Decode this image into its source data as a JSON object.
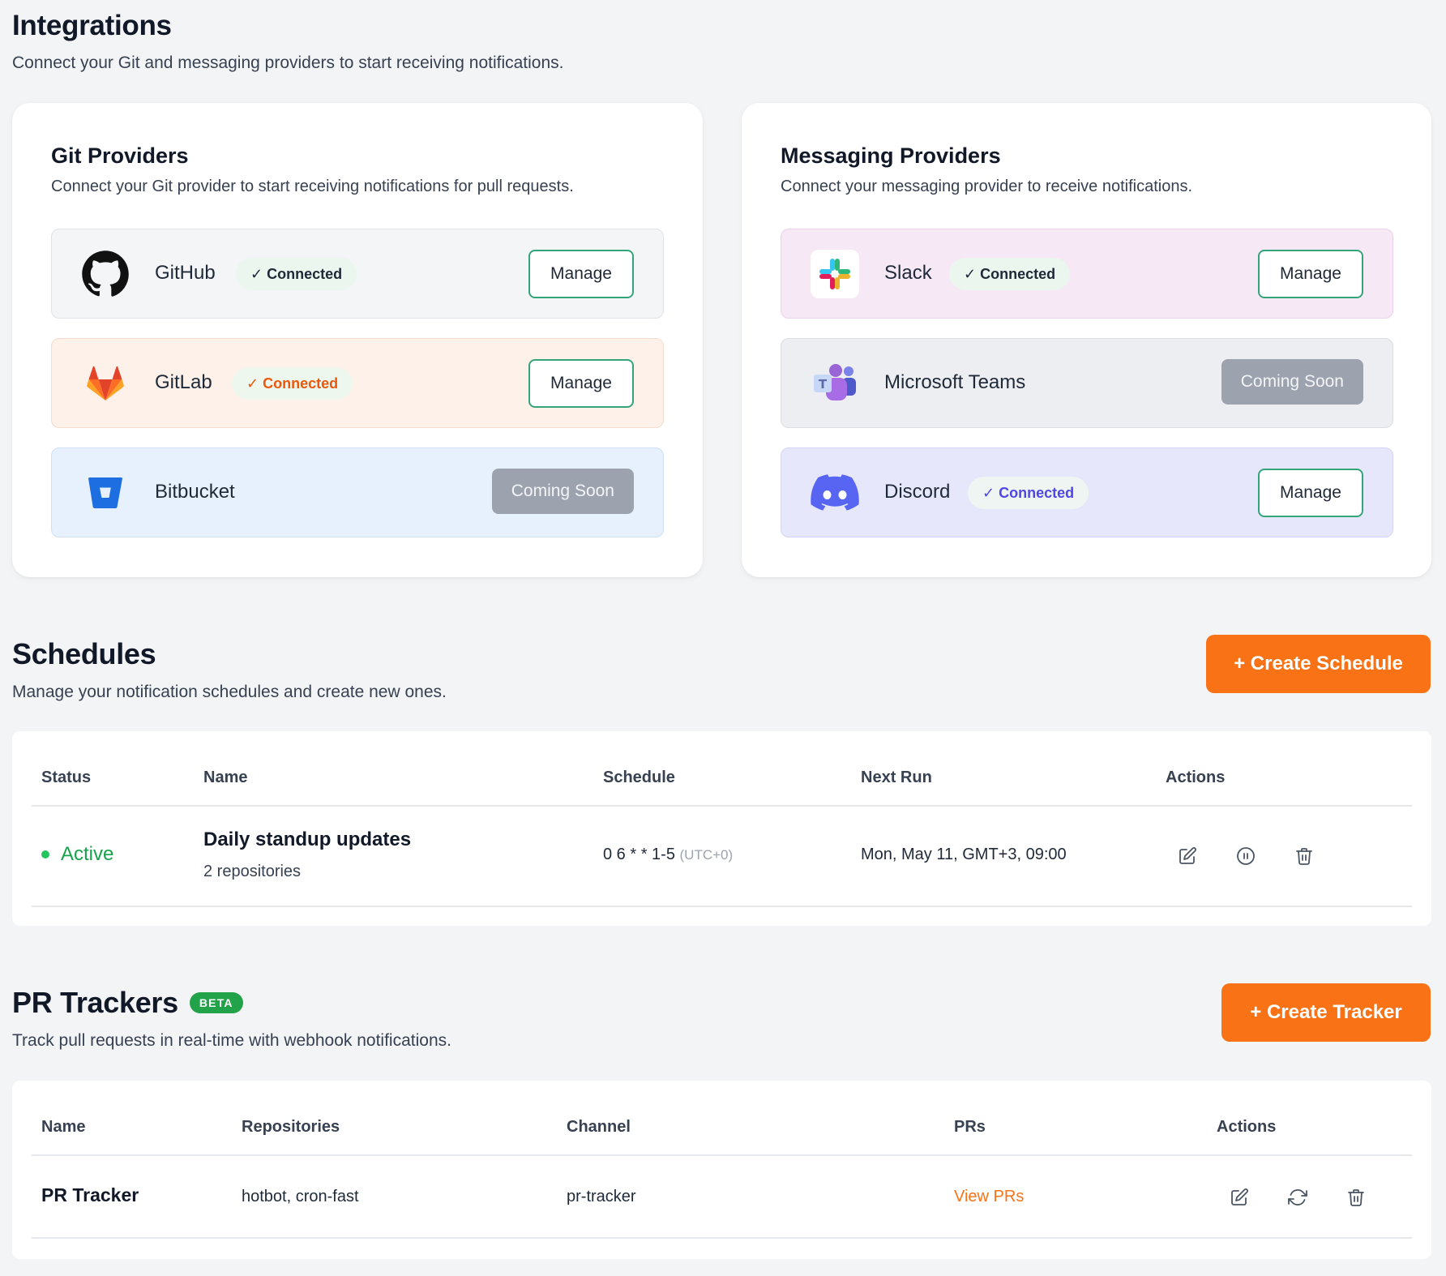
{
  "integrations": {
    "title": "Integrations",
    "subtitle": "Connect your Git and messaging providers to start receiving notifications."
  },
  "git_providers": {
    "title": "Git Providers",
    "subtitle": "Connect your Git provider to start receiving notifications for pull requests.",
    "items": [
      {
        "name": "GitHub",
        "status": "✓ Connected",
        "action": "Manage",
        "icon": "github-icon"
      },
      {
        "name": "GitLab",
        "status": "✓ Connected",
        "action": "Manage",
        "icon": "gitlab-icon"
      },
      {
        "name": "Bitbucket",
        "status": "",
        "action": "Coming Soon",
        "icon": "bitbucket-icon"
      }
    ]
  },
  "messaging_providers": {
    "title": "Messaging Providers",
    "subtitle": "Connect your messaging provider to receive notifications.",
    "items": [
      {
        "name": "Slack",
        "status": "✓ Connected",
        "action": "Manage",
        "icon": "slack-icon"
      },
      {
        "name": "Microsoft Teams",
        "status": "",
        "action": "Coming Soon",
        "icon": "teams-icon"
      },
      {
        "name": "Discord",
        "status": "✓ Connected",
        "action": "Manage",
        "icon": "discord-icon"
      }
    ]
  },
  "schedules": {
    "title": "Schedules",
    "subtitle": "Manage your notification schedules and create new ones.",
    "create_label": "+ Create Schedule",
    "columns": [
      "Status",
      "Name",
      "Schedule",
      "Next Run",
      "Actions"
    ],
    "rows": [
      {
        "status": "Active",
        "name": "Daily standup updates",
        "repos": "2 repositories",
        "cron": "0 6 * * 1-5",
        "tz": "(UTC+0)",
        "next_run": "Mon, May 11, GMT+3, 09:00"
      }
    ]
  },
  "trackers": {
    "title": "PR Trackers",
    "badge": "BETA",
    "subtitle": "Track pull requests in real-time with webhook notifications.",
    "create_label": "+ Create Tracker",
    "columns": [
      "Name",
      "Repositories",
      "Channel",
      "PRs",
      "Actions"
    ],
    "rows": [
      {
        "name": "PR Tracker",
        "repositories": "hotbot, cron-fast",
        "channel": "pr-tracker",
        "prs_link": "View PRs"
      }
    ]
  },
  "colors": {
    "accent": "#f97316",
    "success": "#16a34a",
    "manage_border": "#34a47a",
    "disabled": "#9ca3af"
  }
}
